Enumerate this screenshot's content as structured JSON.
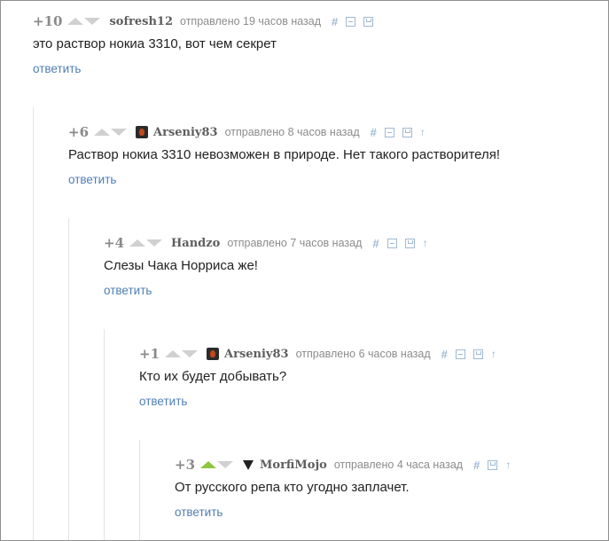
{
  "comments": [
    {
      "rating": "+10",
      "username": "sofresh12",
      "time": "отправлено 19 часов назад",
      "text": "это раствор нокиа 3310, вот чем секрет",
      "reply": "ответить",
      "has_avatar": false,
      "vote_up_active": false,
      "actions": [
        "hash",
        "collapse",
        "save"
      ]
    },
    {
      "rating": "+6",
      "username": "Arseniy83",
      "time": "отправлено 8 часов назад",
      "text": "Раствор нокиа 3310 невозможен в природе. Нет такого растворителя!",
      "reply": "ответить",
      "has_avatar": true,
      "avatar_icon": "flame-avatar-icon",
      "vote_up_active": false,
      "actions": [
        "hash",
        "collapse",
        "save",
        "parent"
      ]
    },
    {
      "rating": "+4",
      "username": "Handzo",
      "time": "отправлено 7 часов назад",
      "text": "Слезы Чака Норриса же!",
      "reply": "ответить",
      "has_avatar": false,
      "vote_up_active": false,
      "actions": [
        "hash",
        "collapse",
        "save",
        "parent"
      ]
    },
    {
      "rating": "+1",
      "username": "Arseniy83",
      "time": "отправлено 6 часов назад",
      "text": "Кто их будет добывать?",
      "reply": "ответить",
      "has_avatar": true,
      "avatar_icon": "flame-avatar-icon",
      "vote_up_active": false,
      "actions": [
        "hash",
        "collapse",
        "save",
        "parent"
      ]
    },
    {
      "rating": "+3",
      "username": "MorfiMojo",
      "time": "отправлено 4 часа назад",
      "text": "От русского репа кто угодно заплачет.",
      "reply": "ответить",
      "has_avatar": true,
      "avatar_icon": "wolf-avatar-icon",
      "vote_up_active": true,
      "actions": [
        "hash",
        "save",
        "parent"
      ]
    }
  ],
  "icons": {
    "hash": "#",
    "parent": "↑"
  },
  "colors": {
    "rating": "#8a8a8a",
    "username": "#5e5e5e",
    "reply_link": "#4f7fb4",
    "vote_up_active": "#8cc63f",
    "vote_inactive": "#d0d0d0"
  }
}
